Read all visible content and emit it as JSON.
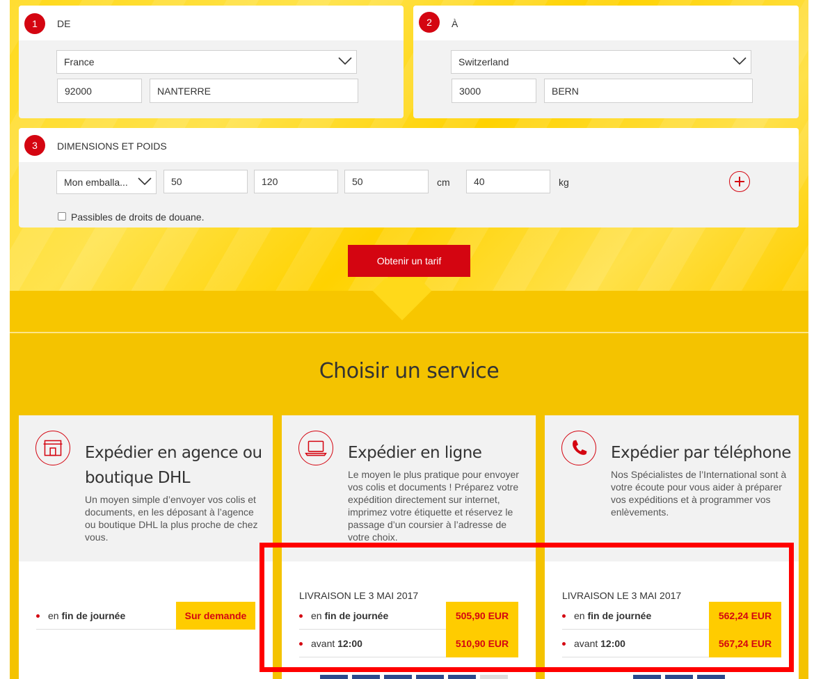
{
  "from": {
    "step": "1",
    "title": "DE",
    "country": "France",
    "postal_code": "92000",
    "city": "NANTERRE"
  },
  "to": {
    "step": "2",
    "title": "À",
    "country": "Switzerland",
    "postal_code": "3000",
    "city": "BERN"
  },
  "dimensions": {
    "step": "3",
    "title": "DIMENSIONS ET POIDS",
    "package": "Mon emballa...",
    "length": "50",
    "width": "120",
    "height": "50",
    "dim_unit": "cm",
    "weight": "40",
    "weight_unit": "kg",
    "customs_label": "Passibles de droits de douane."
  },
  "get_rate_label": "Obtenir un tarif",
  "section_title": "Choisir un service",
  "services": [
    {
      "title": "Expédier en agence ou boutique DHL",
      "icon": "storefront-icon",
      "description": "Un moyen simple d’envoyer vos colis et documents, en les déposant à l’agence ou boutique DHL la plus proche de chez vous.",
      "rows": [
        {
          "prefix": "en ",
          "bold": "fin de journée",
          "price": "Sur demande"
        }
      ]
    },
    {
      "title": "Expédier en ligne",
      "icon": "laptop-icon",
      "description": "Le moyen le plus pratique pour envoyer vos colis et documents ! Préparez votre expédition directement sur internet, imprimez votre étiquette et réservez le passage d’un coursier à l’adresse de votre choix.",
      "delivery": "LIVRAISON LE 3 MAI 2017",
      "rows": [
        {
          "prefix": "en ",
          "bold": "fin de journée",
          "price": "505,90 EUR"
        },
        {
          "prefix": "avant ",
          "bold": "12:00",
          "price": "510,90 EUR"
        }
      ]
    },
    {
      "title": "Expédier par téléphone",
      "icon": "phone-icon",
      "description": "Nos Spécialistes de l’International sont à votre écoute pour vous aider à préparer vos expéditions et à programmer vos enlèvements.",
      "delivery": "LIVRAISON LE 3 MAI 2017",
      "rows": [
        {
          "prefix": "en ",
          "bold": "fin de journée",
          "price": "562,24 EUR"
        },
        {
          "prefix": "avant ",
          "bold": "12:00",
          "price": "567,24 EUR"
        }
      ]
    }
  ],
  "colors": {
    "dhl_red": "#d40511",
    "dhl_yellow": "#ffcc00",
    "highlight_red": "#ff0000"
  }
}
